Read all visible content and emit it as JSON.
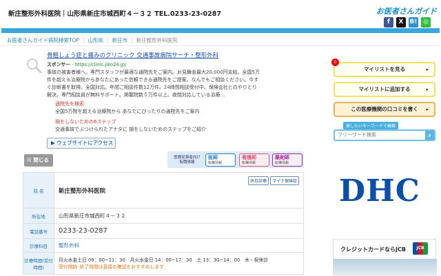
{
  "header": {
    "title": "新庄整形外科医院｜山形県新庄市城西町４－３２ TEL.0233-23-0287",
    "logo": "お医者さんガイド",
    "social": [
      {
        "label": "f",
        "color": "#3b5998"
      },
      {
        "label": "X",
        "color": "#111111"
      },
      {
        "label": "B!",
        "color": "#2f8fd6"
      },
      {
        "label": "◎",
        "color": "#2dbf3c"
      }
    ]
  },
  "breadcrumb": [
    "お医者さんガイド病院検索TOP",
    "山形県",
    "新庄市",
    "新庄整形外科医院"
  ],
  "ad": {
    "title": "骨粗しょう症と痛みのクリニック 交通事故病院サーチ・整形外科",
    "sponsor": "スポンサー",
    "url": "https://clinic.jiko24.jp/",
    "body": "事故の被害者様へ。専門スタッフが最適な通院先をご案内。お見舞金最大20,000円支給。全国5万件を超える治療院からあなたにあった信頼できる通院先をご提案。なんでもご相談ください。今すぐ診断書を取得。全国対応。年間ご相談件数12万件。24時間相談受付中。保険会社とのやりとり解決。専門相談員が無料サポート。掲載院数５万件以上。夜間対応している治療...",
    "links": [
      {
        "title": "通院先を検索",
        "desc": "全国5万院を超える治療院から あなたにぴったりの通院先をご案内"
      },
      {
        "title": "損をしないための6ステップ",
        "desc": "交通事故でぶつけられたアナタに 損をしないためのステップをご紹介"
      }
    ],
    "visit": "▶ ウェブサイトにアクセス"
  },
  "close": "閉じる",
  "jobs": {
    "intro": "医療従事者向け 転職情報",
    "items": [
      {
        "title": "医師",
        "sub": "転職情報",
        "color": "#2a7fc0"
      },
      {
        "title": "看護師",
        "sub": "転職情報",
        "color": "#e0557a"
      },
      {
        "title": "薬剤師",
        "sub": "転職情報",
        "color": "#a02a9a"
      }
    ]
  },
  "clinic": {
    "tags": [
      "休日診療",
      "マイナ保険証"
    ],
    "rows": [
      {
        "label": "院 名",
        "value": "新庄整形外科医院"
      },
      {
        "label": "所在地",
        "value": "山形県新庄市城西町４－３２"
      },
      {
        "label": "電話番号",
        "value": "0233-23-0287"
      },
      {
        "label": "診療科目",
        "value": "整形外科"
      },
      {
        "label": "診療時間(受付時間)",
        "value": "月火水金土日 09：00~11：30　月火水金日 14：00~17：30　土 13：30~14：00　木・祝休診",
        "note": "受付開始･終了時間は直接の確認をおすすめします"
      }
    ]
  },
  "sidebar": {
    "badge": "0",
    "buttons": [
      "マイリストを見る",
      "マイリストに追加する",
      "この医療機関の口コミを書く"
    ],
    "keyword_label": "探したいキーワードで検索",
    "search_placeholder": "フリーワード検索"
  },
  "ads": {
    "dhc": "DHC",
    "jcb": "クレジットカードならJCB",
    "jcb_logo": "JCB"
  }
}
